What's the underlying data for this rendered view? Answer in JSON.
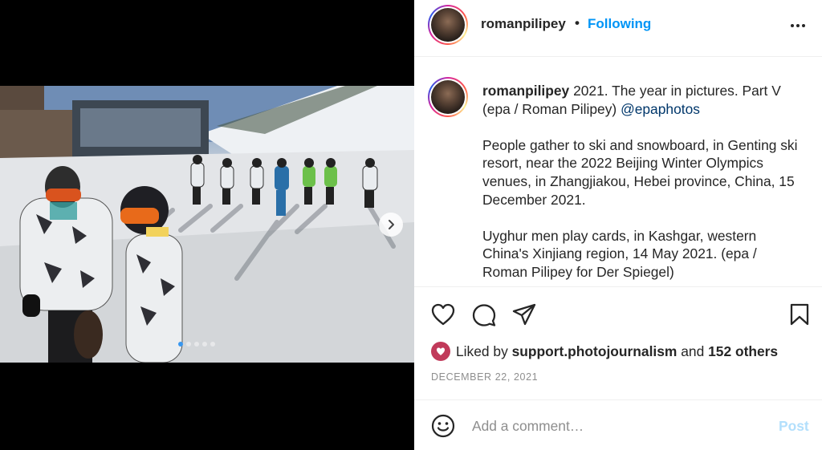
{
  "post": {
    "username": "romanpilipey",
    "separator": "•",
    "follow_status": "Following",
    "more_icon": "more-horizontal-icon"
  },
  "media": {
    "carousel_count": 5,
    "active_index": 0,
    "next_icon": "chevron-right-icon"
  },
  "caption": {
    "username": "romanpilipey",
    "line1": "2021. The year in pictures. Part V (epa / Roman Pilipey)",
    "mention": "@epaphotos",
    "paragraph2": "People gather to ski and snowboard, in Genting ski resort, near the 2022 Beijing Winter Olympics venues, in Zhangjiakou, Hebei province, China, 15 December 2021.",
    "paragraph3": "Uyghur men play cards, in Kashgar, western China's Xinjiang region, 14 May 2021. (epa / Roman Pilipey for Der Spiegel)"
  },
  "actions": {
    "like_icon": "heart-icon",
    "comment_icon": "comment-icon",
    "share_icon": "paper-plane-icon",
    "save_icon": "bookmark-icon"
  },
  "likes": {
    "prefix": "Liked by",
    "liker": "support.photojournalism",
    "connector": "and",
    "others": "152 others"
  },
  "date": "DECEMBER 22, 2021",
  "comment": {
    "placeholder": "Add a comment…",
    "post_label": "Post",
    "emoji_icon": "smiley-icon"
  },
  "colors": {
    "link_blue": "#0095f6",
    "mention_blue": "#00376b",
    "post_disabled": "#b2dffc",
    "muted": "#8e8e8e",
    "text": "#262626"
  }
}
